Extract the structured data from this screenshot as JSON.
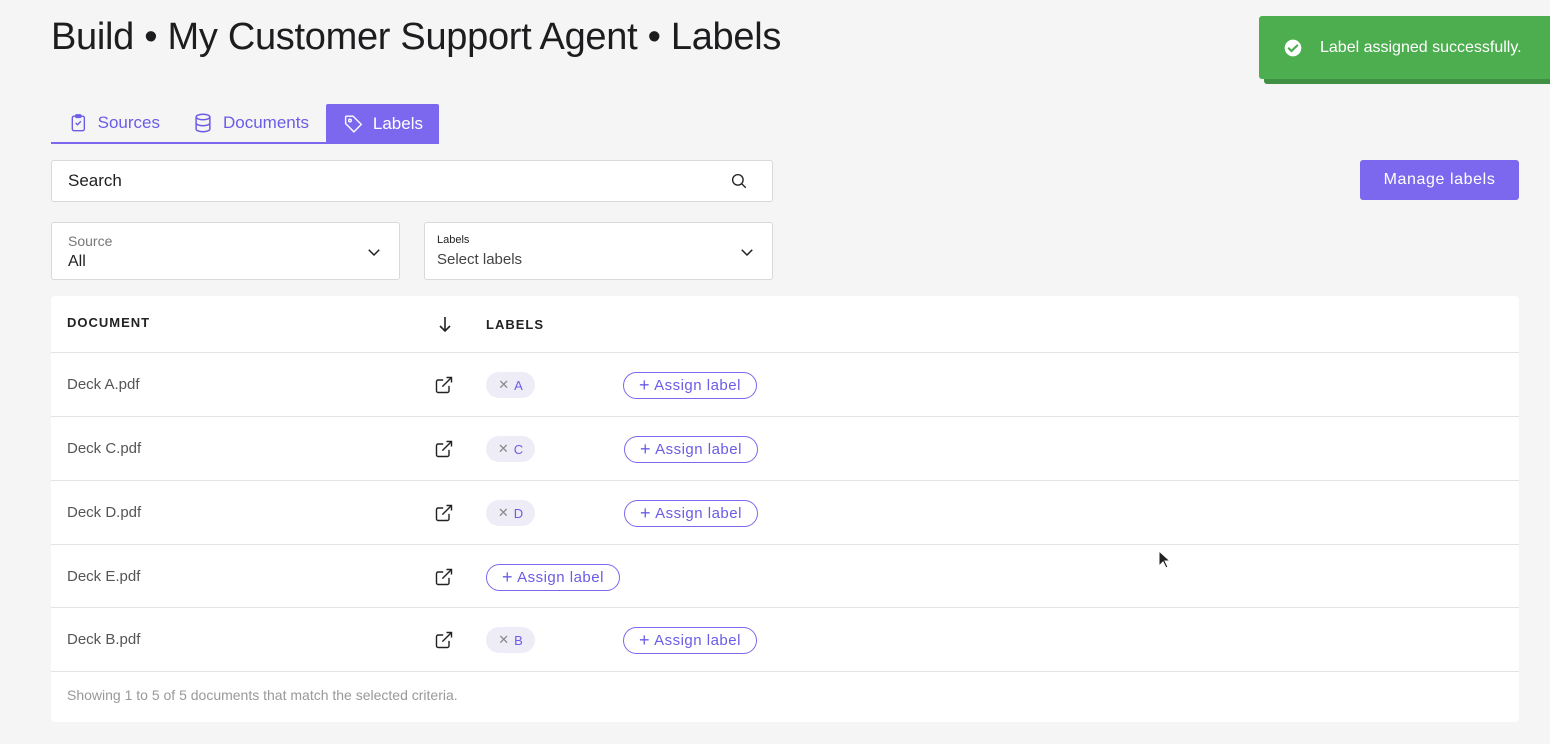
{
  "header": {
    "title": "Build • My Customer Support Agent • Labels"
  },
  "tabs": [
    {
      "label": "Sources",
      "icon": "clipboard-icon",
      "active": false
    },
    {
      "label": "Documents",
      "icon": "database-icon",
      "active": false
    },
    {
      "label": "Labels",
      "icon": "tag-icon",
      "active": true
    }
  ],
  "search": {
    "placeholder": "Search",
    "value": ""
  },
  "manage_labels_label": "Manage labels",
  "filters": {
    "source": {
      "label": "Source",
      "value": "All"
    },
    "labels": {
      "label": "Labels",
      "value": "Select labels"
    }
  },
  "table": {
    "columns": {
      "document": "DOCUMENT",
      "labels": "LABELS"
    },
    "rows": [
      {
        "document": "Deck A.pdf",
        "labels": [
          "A"
        ],
        "assign_label": "Assign label"
      },
      {
        "document": "Deck C.pdf",
        "labels": [
          "C"
        ],
        "assign_label": "Assign label"
      },
      {
        "document": "Deck D.pdf",
        "labels": [
          "D"
        ],
        "assign_label": "Assign label"
      },
      {
        "document": "Deck E.pdf",
        "labels": [],
        "assign_label": "Assign label"
      },
      {
        "document": "Deck B.pdf",
        "labels": [
          "B"
        ],
        "assign_label": "Assign label"
      }
    ],
    "footer": "Showing 1 to 5 of 5 documents that match the selected criteria."
  },
  "toast": {
    "message": "Label assigned successfully.",
    "icon": "check-circle-icon"
  },
  "colors": {
    "accent": "#7b68ee",
    "success": "#4cae4f",
    "chip_bg": "#eeedf7"
  }
}
